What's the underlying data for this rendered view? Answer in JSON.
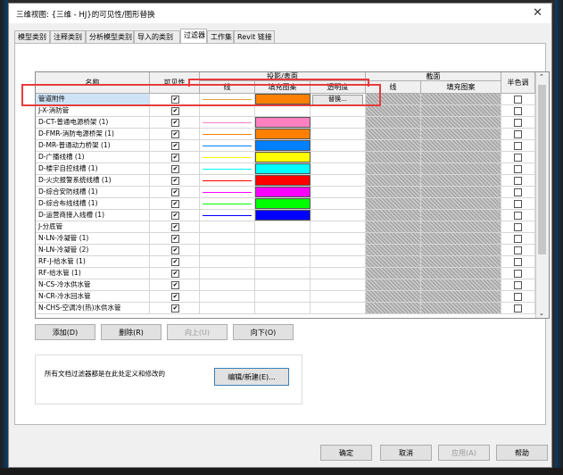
{
  "window": {
    "title": "三维视图: {三维 - HJ}的可见性/图形替换"
  },
  "tabs": [
    "模型类别",
    "注释类别",
    "分析模型类别",
    "导入的类别",
    "过滤器",
    "工作集",
    "Revit 链接"
  ],
  "active_tab": 4,
  "table": {
    "headers": {
      "name": "名称",
      "visibility": "可见性",
      "projection_surface": "投影/表面",
      "lines": "线",
      "fill_pattern": "填充图案",
      "transparency": "透明度",
      "section": "截面",
      "section_lines": "线",
      "section_fill": "填充图案",
      "halftone": "半色调"
    },
    "rows": [
      {
        "name": "管道附件",
        "visible": true,
        "line_color": "#e0a040",
        "fill_color": "#ff8000",
        "transparency": "替换...",
        "selected": true
      },
      {
        "name": "J-X-消防管",
        "visible": true,
        "line_color": "",
        "fill_color": ""
      },
      {
        "name": "D-CT-普通电源桥架 (1)",
        "visible": true,
        "line_color": "#ff80c0",
        "fill_color": "#ff80c0"
      },
      {
        "name": "D-FMR-消防电源桥架 (1)",
        "visible": true,
        "line_color": "#ff8000",
        "fill_color": "#ff8000"
      },
      {
        "name": "D-MR-普通动力桥架 (1)",
        "visible": true,
        "line_color": "#0080ff",
        "fill_color": "#0080ff"
      },
      {
        "name": "D-广播线槽 (1)",
        "visible": true,
        "line_color": "#ffff00",
        "fill_color": "#ffff00"
      },
      {
        "name": "D-楼宇自控线槽 (1)",
        "visible": true,
        "line_color": "#00ffff",
        "fill_color": "#00ffff"
      },
      {
        "name": "D-火灾报警系统线槽 (1)",
        "visible": true,
        "line_color": "#ff0000",
        "fill_color": "#ff0000"
      },
      {
        "name": "D-综合安防线槽 (1)",
        "visible": true,
        "line_color": "#ff00ff",
        "fill_color": "#ff00ff"
      },
      {
        "name": "D-综合布线线槽 (1)",
        "visible": true,
        "line_color": "#00ff00",
        "fill_color": "#00ff00"
      },
      {
        "name": "D-运营商接入线槽 (1)",
        "visible": true,
        "line_color": "#0000ff",
        "fill_color": "#0000ff"
      },
      {
        "name": "J-分底管",
        "visible": true,
        "line_color": "",
        "fill_color": ""
      },
      {
        "name": "N-LN-冷凝管 (1)",
        "visible": true,
        "line_color": "",
        "fill_color": ""
      },
      {
        "name": "N-LN-冷凝管 (2)",
        "visible": true,
        "line_color": "",
        "fill_color": ""
      },
      {
        "name": "RF-J-给水管 (1)",
        "visible": true,
        "line_color": "",
        "fill_color": ""
      },
      {
        "name": "RF-给水管 (1)",
        "visible": true,
        "line_color": "",
        "fill_color": ""
      },
      {
        "name": "N-CS-冷水供水管",
        "visible": true,
        "line_color": "",
        "fill_color": ""
      },
      {
        "name": "N-CR-冷水回水管",
        "visible": true,
        "line_color": "",
        "fill_color": ""
      },
      {
        "name": "N-CHS-空调冷(热)水供水管",
        "visible": true,
        "line_color": "",
        "fill_color": ""
      }
    ]
  },
  "buttons": {
    "add": "添加(D)",
    "delete": "删除(R)",
    "up": "向上(U)",
    "down": "向下(O)",
    "edit_new": "编辑/新建(E)...",
    "ok": "确定",
    "cancel": "取消",
    "apply": "应用(A)",
    "help": "帮助"
  },
  "note": "所有文档过滤器都是在此处定义和修改的",
  "highlight_color": "#e53c3c"
}
